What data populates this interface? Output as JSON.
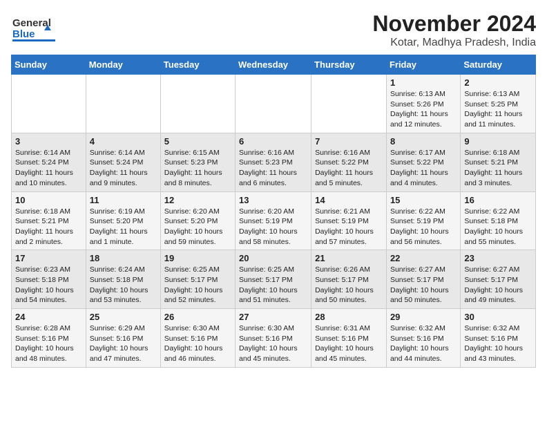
{
  "header": {
    "logo_line1": "General",
    "logo_line2": "Blue",
    "title": "November 2024",
    "subtitle": "Kotar, Madhya Pradesh, India"
  },
  "calendar": {
    "days_of_week": [
      "Sunday",
      "Monday",
      "Tuesday",
      "Wednesday",
      "Thursday",
      "Friday",
      "Saturday"
    ],
    "weeks": [
      [
        {
          "day": "",
          "info": ""
        },
        {
          "day": "",
          "info": ""
        },
        {
          "day": "",
          "info": ""
        },
        {
          "day": "",
          "info": ""
        },
        {
          "day": "",
          "info": ""
        },
        {
          "day": "1",
          "info": "Sunrise: 6:13 AM\nSunset: 5:26 PM\nDaylight: 11 hours and 12 minutes."
        },
        {
          "day": "2",
          "info": "Sunrise: 6:13 AM\nSunset: 5:25 PM\nDaylight: 11 hours and 11 minutes."
        }
      ],
      [
        {
          "day": "3",
          "info": "Sunrise: 6:14 AM\nSunset: 5:24 PM\nDaylight: 11 hours and 10 minutes."
        },
        {
          "day": "4",
          "info": "Sunrise: 6:14 AM\nSunset: 5:24 PM\nDaylight: 11 hours and 9 minutes."
        },
        {
          "day": "5",
          "info": "Sunrise: 6:15 AM\nSunset: 5:23 PM\nDaylight: 11 hours and 8 minutes."
        },
        {
          "day": "6",
          "info": "Sunrise: 6:16 AM\nSunset: 5:23 PM\nDaylight: 11 hours and 6 minutes."
        },
        {
          "day": "7",
          "info": "Sunrise: 6:16 AM\nSunset: 5:22 PM\nDaylight: 11 hours and 5 minutes."
        },
        {
          "day": "8",
          "info": "Sunrise: 6:17 AM\nSunset: 5:22 PM\nDaylight: 11 hours and 4 minutes."
        },
        {
          "day": "9",
          "info": "Sunrise: 6:18 AM\nSunset: 5:21 PM\nDaylight: 11 hours and 3 minutes."
        }
      ],
      [
        {
          "day": "10",
          "info": "Sunrise: 6:18 AM\nSunset: 5:21 PM\nDaylight: 11 hours and 2 minutes."
        },
        {
          "day": "11",
          "info": "Sunrise: 6:19 AM\nSunset: 5:20 PM\nDaylight: 11 hours and 1 minute."
        },
        {
          "day": "12",
          "info": "Sunrise: 6:20 AM\nSunset: 5:20 PM\nDaylight: 10 hours and 59 minutes."
        },
        {
          "day": "13",
          "info": "Sunrise: 6:20 AM\nSunset: 5:19 PM\nDaylight: 10 hours and 58 minutes."
        },
        {
          "day": "14",
          "info": "Sunrise: 6:21 AM\nSunset: 5:19 PM\nDaylight: 10 hours and 57 minutes."
        },
        {
          "day": "15",
          "info": "Sunrise: 6:22 AM\nSunset: 5:19 PM\nDaylight: 10 hours and 56 minutes."
        },
        {
          "day": "16",
          "info": "Sunrise: 6:22 AM\nSunset: 5:18 PM\nDaylight: 10 hours and 55 minutes."
        }
      ],
      [
        {
          "day": "17",
          "info": "Sunrise: 6:23 AM\nSunset: 5:18 PM\nDaylight: 10 hours and 54 minutes."
        },
        {
          "day": "18",
          "info": "Sunrise: 6:24 AM\nSunset: 5:18 PM\nDaylight: 10 hours and 53 minutes."
        },
        {
          "day": "19",
          "info": "Sunrise: 6:25 AM\nSunset: 5:17 PM\nDaylight: 10 hours and 52 minutes."
        },
        {
          "day": "20",
          "info": "Sunrise: 6:25 AM\nSunset: 5:17 PM\nDaylight: 10 hours and 51 minutes."
        },
        {
          "day": "21",
          "info": "Sunrise: 6:26 AM\nSunset: 5:17 PM\nDaylight: 10 hours and 50 minutes."
        },
        {
          "day": "22",
          "info": "Sunrise: 6:27 AM\nSunset: 5:17 PM\nDaylight: 10 hours and 50 minutes."
        },
        {
          "day": "23",
          "info": "Sunrise: 6:27 AM\nSunset: 5:17 PM\nDaylight: 10 hours and 49 minutes."
        }
      ],
      [
        {
          "day": "24",
          "info": "Sunrise: 6:28 AM\nSunset: 5:16 PM\nDaylight: 10 hours and 48 minutes."
        },
        {
          "day": "25",
          "info": "Sunrise: 6:29 AM\nSunset: 5:16 PM\nDaylight: 10 hours and 47 minutes."
        },
        {
          "day": "26",
          "info": "Sunrise: 6:30 AM\nSunset: 5:16 PM\nDaylight: 10 hours and 46 minutes."
        },
        {
          "day": "27",
          "info": "Sunrise: 6:30 AM\nSunset: 5:16 PM\nDaylight: 10 hours and 45 minutes."
        },
        {
          "day": "28",
          "info": "Sunrise: 6:31 AM\nSunset: 5:16 PM\nDaylight: 10 hours and 45 minutes."
        },
        {
          "day": "29",
          "info": "Sunrise: 6:32 AM\nSunset: 5:16 PM\nDaylight: 10 hours and 44 minutes."
        },
        {
          "day": "30",
          "info": "Sunrise: 6:32 AM\nSunset: 5:16 PM\nDaylight: 10 hours and 43 minutes."
        }
      ]
    ]
  }
}
